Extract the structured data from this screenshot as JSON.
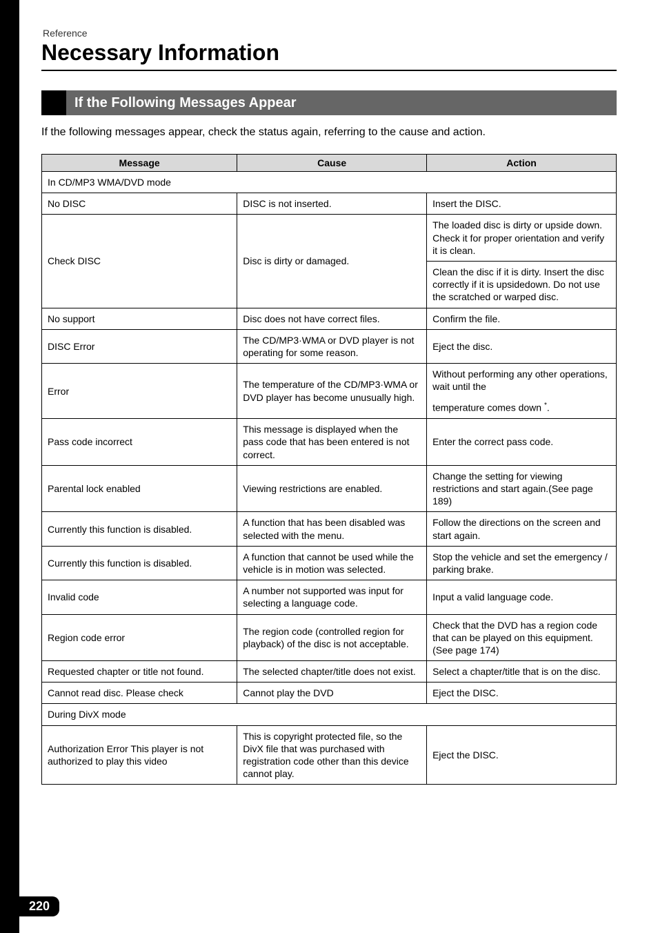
{
  "header": {
    "reference_label": "Reference",
    "page_title": "Necessary Information"
  },
  "section": {
    "title": "If the Following Messages Appear",
    "intro": "If the following messages appear, check the status again, referring to the cause and action."
  },
  "table": {
    "columns": [
      "Message",
      "Cause",
      "Action"
    ],
    "mode_rows": [
      {
        "text": "In CD/MP3 WMA/DVD mode"
      },
      {
        "text": "During DivX mode"
      }
    ],
    "rows_group1": [
      {
        "message": "No DISC",
        "cause": "DISC is not inserted.",
        "action": "Insert the DISC."
      },
      {
        "message": "Check DISC",
        "cause": "Disc is dirty or damaged.",
        "action_top": "The loaded disc is dirty or upside down. Check it for proper orientation and verify it is clean.",
        "action_bottom": "Clean the disc if it is dirty. Insert the disc correctly if it is upsidedown. Do not use the scratched or warped disc."
      },
      {
        "message": "No support",
        "cause": "Disc does not have correct files.",
        "action": "Confirm the file."
      },
      {
        "message": "DISC Error",
        "cause": "The CD/MP3·WMA or DVD player is not operating for some reason.",
        "action": "Eject the disc."
      },
      {
        "message": "Error",
        "cause": "The temperature of the CD/MP3·WMA or DVD player has become unusually high.",
        "action_top": "Without performing any other operations, wait until the",
        "action_bottom": "temperature comes down ",
        "action_sup": "*",
        "action_suffix": "."
      },
      {
        "message": "Pass code incorrect",
        "cause": "This message is displayed when the pass code that has been entered is not correct.",
        "action": "Enter the correct pass code."
      },
      {
        "message": "Parental lock enabled",
        "cause": "Viewing restrictions are enabled.",
        "action": "Change the setting for viewing restrictions and start again.(See page 189)"
      },
      {
        "message": "Currently this function is disabled.",
        "cause": "A function that has been disabled was selected with the menu.",
        "action": "Follow the directions on the screen and start again."
      },
      {
        "message": "Currently this function is disabled.",
        "cause": "A function that cannot be used while the vehicle is in motion was selected.",
        "action": "Stop the vehicle and set the emergency / parking brake."
      },
      {
        "message": "Invalid code",
        "cause": "A number not supported was input for selecting a language code.",
        "action": "Input a valid language code."
      },
      {
        "message": "Region code error",
        "cause": "The region code (controlled region for playback) of the disc is not acceptable.",
        "action": "Check that the DVD has a region code that can be played on this equipment.(See page 174)"
      },
      {
        "message": "Requested chapter or title not found.",
        "cause": "The selected chapter/title does not exist.",
        "action": "Select a chapter/title that is on the disc."
      },
      {
        "message": "Cannot read disc. Please check",
        "cause": "Cannot play the DVD",
        "action": "Eject the DISC."
      }
    ],
    "rows_group2": [
      {
        "message": "Authorization Error This player is not authorized to play this video",
        "cause": "This is copyright protected file, so the DivX file that was purchased with registration code other than this device cannot play.",
        "action": "Eject the DISC."
      }
    ]
  },
  "footer": {
    "page_number": "220"
  }
}
